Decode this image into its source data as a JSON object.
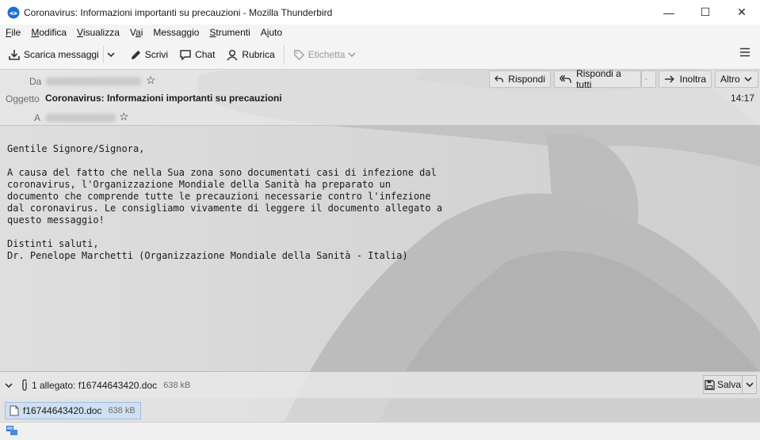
{
  "window": {
    "title": "Coronavirus: Informazioni importanti su precauzioni - Mozilla Thunderbird",
    "minimize": "—",
    "maximize": "☐",
    "close": "✕"
  },
  "menu": [
    {
      "label": "File",
      "accesskey": "F",
      "rest": "ile"
    },
    {
      "label": "Modifica",
      "accesskey": "M",
      "rest": "odifica"
    },
    {
      "label": "Visualizza",
      "accesskey": "V",
      "rest": "isualizza"
    },
    {
      "label": "Vai",
      "pre": "V",
      "accesskey": "a",
      "rest": "i"
    },
    {
      "label": "Messaggio",
      "pre": "Messa",
      "accesskey": "g",
      "rest": "gio"
    },
    {
      "label": "Strumenti",
      "accesskey": "S",
      "rest": "trumenti"
    },
    {
      "label": "Aiuto",
      "pre": "A",
      "accesskey": "i",
      "rest": "uto"
    }
  ],
  "toolbar": {
    "get_messages": "Scarica messaggi",
    "write": "Scrivi",
    "chat": "Chat",
    "address_book": "Rubrica",
    "tag": "Etichetta"
  },
  "header": {
    "from_label": "Da",
    "subject_label": "Oggetto",
    "to_label": "A",
    "subject": "Coronavirus: Informazioni importanti su precauzioni",
    "time": "14:17",
    "reply": "Rispondi",
    "reply_all": "Rispondi a tutti",
    "forward": "Inoltra",
    "more": "Altro"
  },
  "body": "Gentile Signore/Signora,\n\nA causa del fatto che nella Sua zona sono documentati casi di infezione dal\ncoronavirus, l'Organizzazione Mondiale della Sanità ha preparato un\ndocumento che comprende tutte le precauzioni necessarie contro l'infezione\ndal coronavirus. Le consigliamo vivamente di leggere il documento allegato a\nquesto messaggio!\n\nDistinti saluti,\nDr. Penelope Marchetti (Organizzazione Mondiale della Sanità - Italia)",
  "attachments": {
    "summary": "1 allegato: f16744643420.doc",
    "summary_size": "638 kB",
    "save": "Salva",
    "file_name": "f16744643420.doc",
    "file_size": "638 kB"
  },
  "colors": {
    "accent": "#cfe0f3",
    "chrome": "#f4f4f4"
  }
}
